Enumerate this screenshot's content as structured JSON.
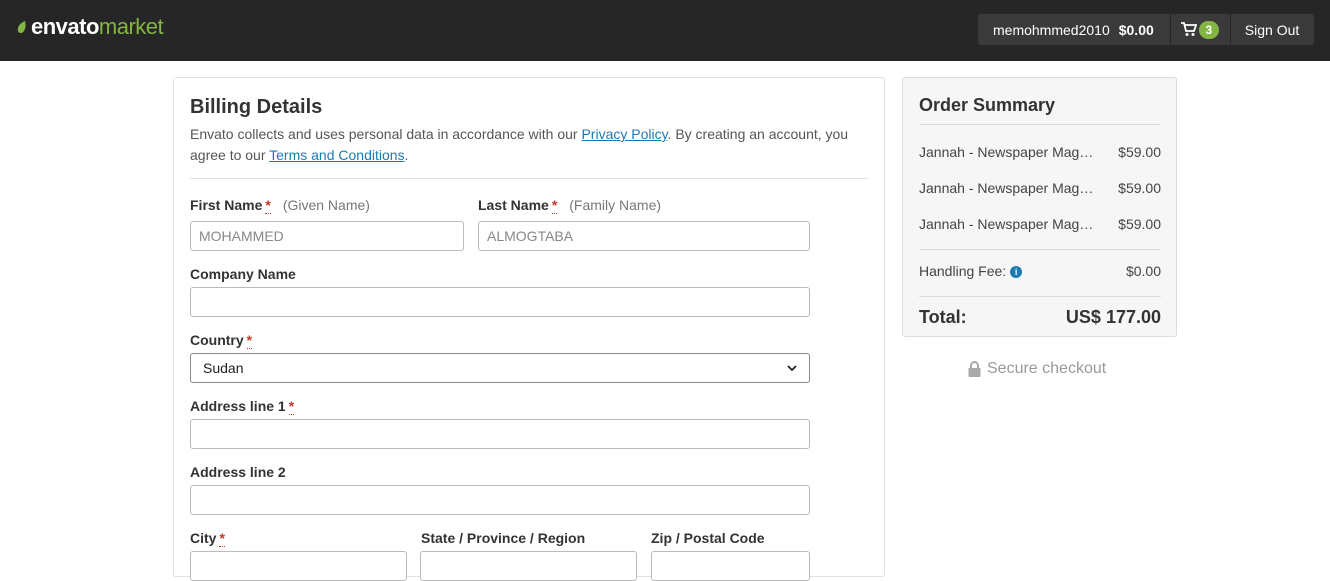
{
  "header": {
    "logo_part1": "envato",
    "logo_part2": "market",
    "username": "memohmmed2010",
    "balance": "$0.00",
    "cart_count": "3",
    "sign_out": "Sign Out",
    "colors": {
      "bar": "#262626",
      "accent": "#82b541"
    }
  },
  "billing": {
    "title": "Billing Details",
    "intro_before": "Envato collects and uses personal data in accordance with our ",
    "privacy_link": "Privacy Policy",
    "intro_middle": ". By creating an account, you agree to our ",
    "terms_link": "Terms and Conditions",
    "intro_end": ".",
    "required_mark": "*",
    "first_name": {
      "label": "First Name",
      "hint": "(Given Name)",
      "placeholder": "MOHAMMED"
    },
    "last_name": {
      "label": "Last Name",
      "hint": "(Family Name)",
      "placeholder": "ALMOGTABA"
    },
    "company": {
      "label": "Company Name",
      "value": ""
    },
    "country": {
      "label": "Country",
      "value": "Sudan"
    },
    "address1": {
      "label": "Address line 1",
      "value": ""
    },
    "address2": {
      "label": "Address line 2",
      "value": ""
    },
    "city": {
      "label": "City"
    },
    "state": {
      "label": "State / Province / Region"
    },
    "zip": {
      "label": "Zip / Postal Code"
    }
  },
  "summary": {
    "title": "Order Summary",
    "items": [
      {
        "name": "Jannah - Newspaper Magazine News BuddyPress AMP",
        "price": "$59.00"
      },
      {
        "name": "Jannah - Newspaper Magazine News BuddyPress AMP",
        "price": "$59.00"
      },
      {
        "name": "Jannah - Newspaper Magazine News BuddyPress AMP",
        "price": "$59.00"
      }
    ],
    "handling_label": "Handling Fee:",
    "handling_value": "$0.00",
    "total_label": "Total:",
    "total_value": "US$ 177.00",
    "secure": "Secure checkout"
  }
}
